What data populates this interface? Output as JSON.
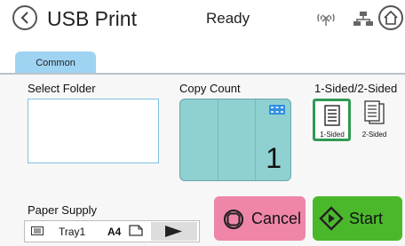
{
  "header": {
    "title": "USB Print",
    "status": "Ready"
  },
  "tabs": [
    {
      "label": "Common",
      "active": true
    }
  ],
  "select_folder": {
    "label": "Select Folder"
  },
  "copy_count": {
    "label": "Copy Count",
    "value": "1"
  },
  "sided": {
    "label": "1-Sided/2-Sided",
    "options": [
      {
        "label": "1-Sided",
        "selected": true
      },
      {
        "label": "2-Sided",
        "selected": false
      }
    ]
  },
  "paper_supply": {
    "label": "Paper Supply",
    "tray": "Tray1",
    "size": "A4"
  },
  "actions": {
    "cancel_label": "Cancel",
    "start_label": "Start"
  },
  "icons": {
    "back": "back-arrow-icon",
    "wireless": "wireless-off-icon",
    "network": "wired-network-icon",
    "home": "home-icon",
    "keypad": "numeric-keypad-icon",
    "one_sided": "one-sided-document-icon",
    "two_sided": "two-sided-document-icon",
    "tray": "paper-tray-icon",
    "orientation": "paper-orientation-icon",
    "arrow": "play-arrow-icon",
    "cancel": "stop-icon",
    "start": "start-icon"
  },
  "colors": {
    "tab_active": "#9fd3f2",
    "folder_border": "#7ec3e6",
    "copy_count_bg": "#8fd0d0",
    "selected_border": "#2f9a52",
    "cancel_bg": "#ef86a8",
    "start_bg": "#4bb82c"
  }
}
